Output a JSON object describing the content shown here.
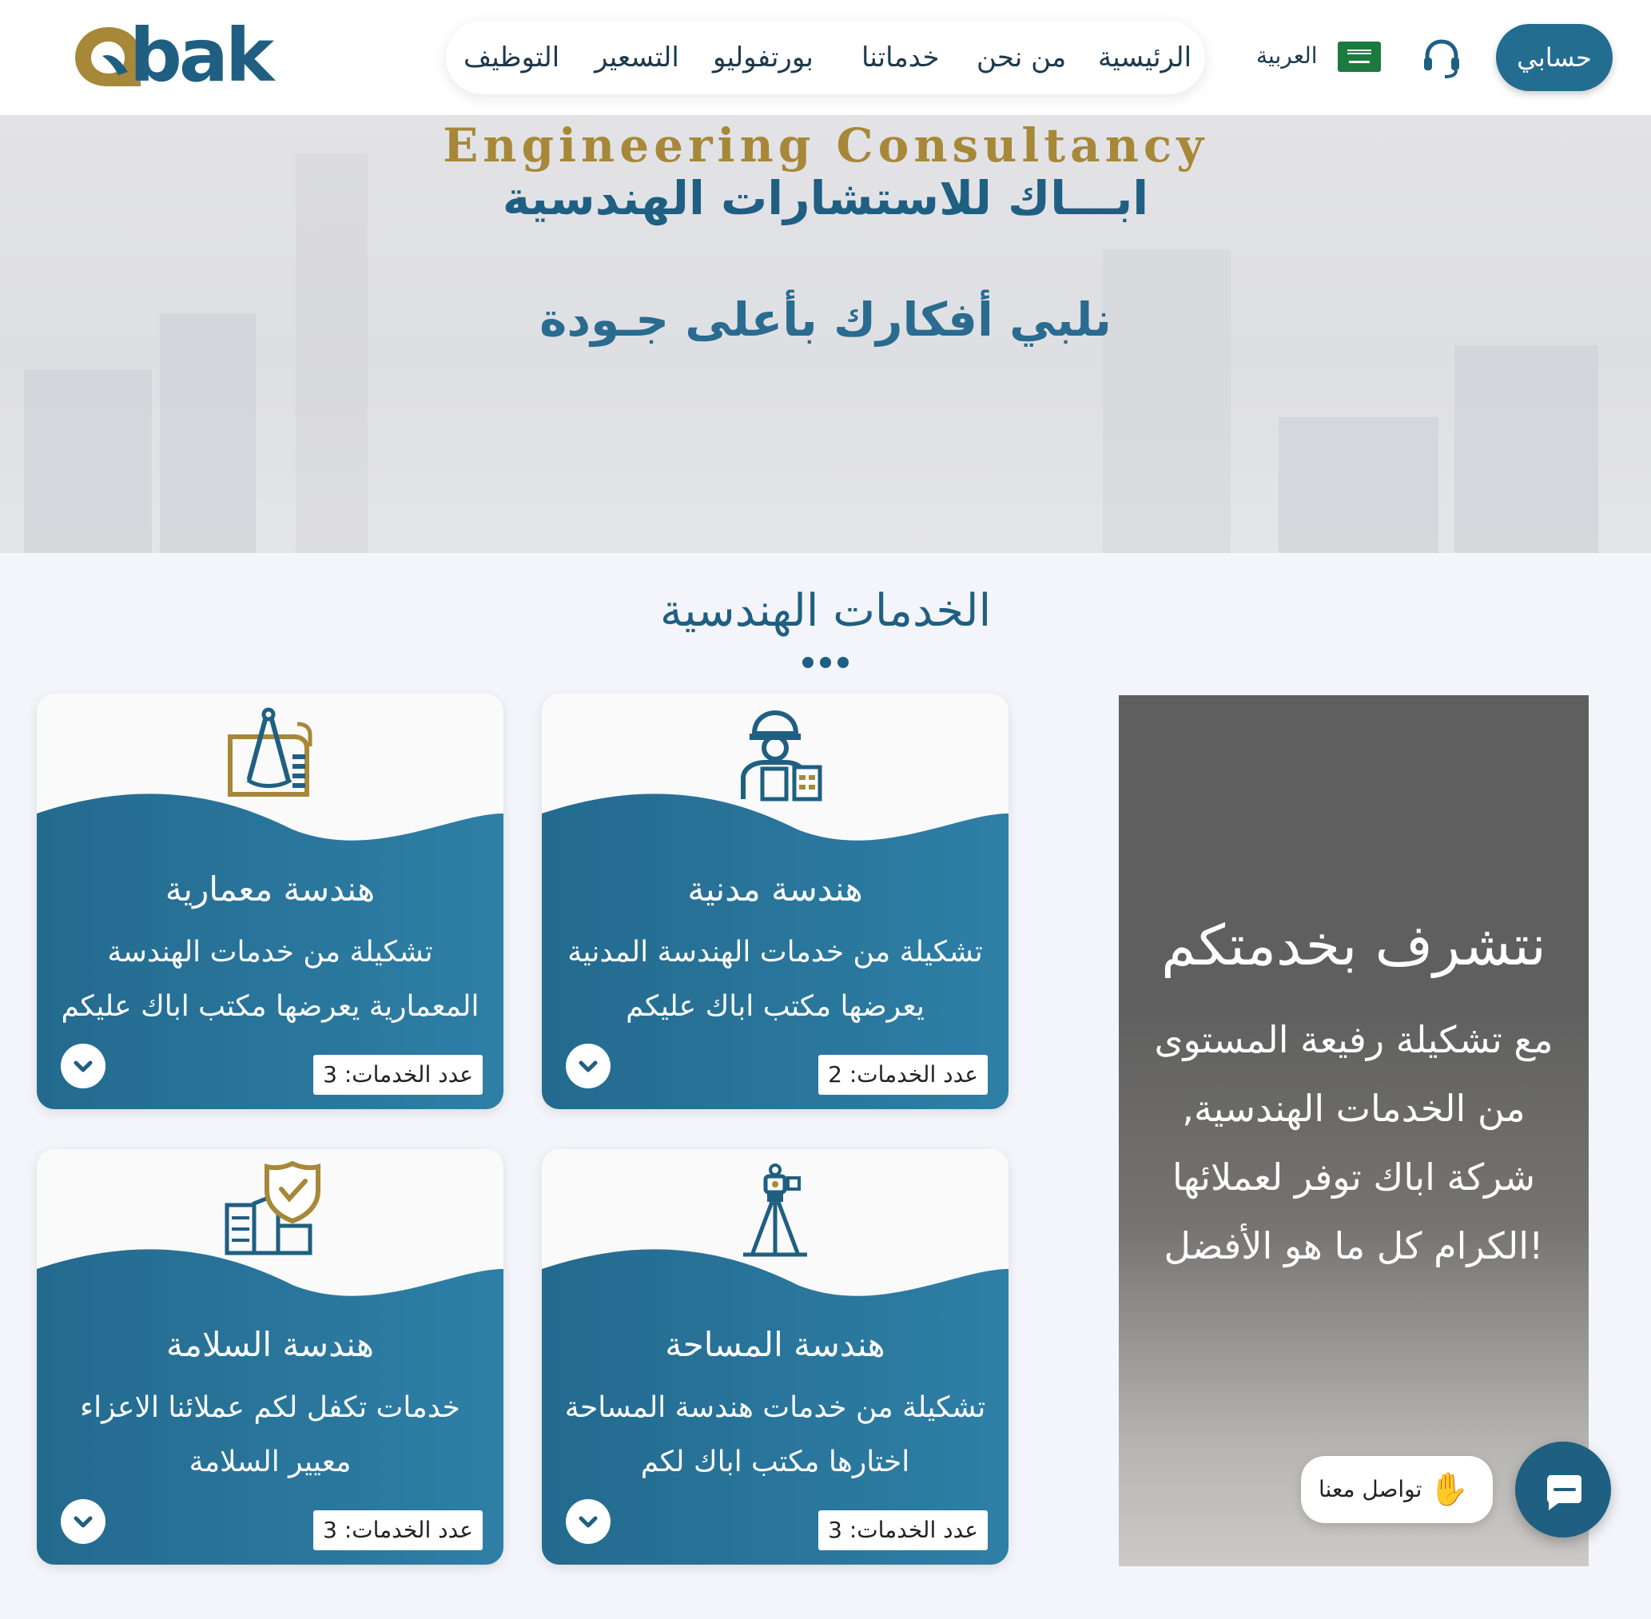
{
  "header": {
    "logo_text": "bak",
    "nav": [
      {
        "label": "الرئيسية"
      },
      {
        "label": "من نحن"
      },
      {
        "label": "خدماتنا"
      },
      {
        "label": "بورتفوليو"
      },
      {
        "label": "التسعير"
      },
      {
        "label": "التوظيف"
      }
    ],
    "language": "العربية",
    "language_flag": "saudi-flag-icon",
    "support_icon": "headset-icon",
    "account_label": "حسابي"
  },
  "hero": {
    "title_en": "Engineering Consultancy",
    "title_ar": "ابـــاك للاستشارات الهندسية",
    "tagline": "نلبي أفكارك بأعلى جـودة"
  },
  "services": {
    "title": "الخدمات الهندسية",
    "cards": [
      {
        "icon": "engineer-icon",
        "title": "هندسة مدنية",
        "description": "تشكيلة من خدمات الهندسة المدنية يعرضها مكتب اباك عليكم",
        "count": "عدد الخدمات: 2"
      },
      {
        "icon": "compass-blueprint-icon",
        "title": "هندسة معمارية",
        "description": "تشكيلة من خدمات الهندسة المعمارية يعرضها مكتب اباك عليكم",
        "count": "عدد الخدمات: 3"
      },
      {
        "icon": "surveying-tripod-icon",
        "title": "هندسة المساحة",
        "description": "تشكيلة من خدمات هندسة المساحة اختارها مكتب اباك لكم",
        "count": "عدد الخدمات: 3"
      },
      {
        "icon": "safety-shield-icon",
        "title": "هندسة السلامة",
        "description": "خدمات تكفل لكم عملائنا الاعزاء معيير السلامة",
        "count": "عدد الخدمات: 3"
      }
    ]
  },
  "side_panel": {
    "title": "نتشرف بخدمتكم",
    "text": "مع تشكيلة رفيعة المستوى من الخدمات الهندسية, شركة اباك توفر لعملائها الكرام كل ما هو الأفضل!"
  },
  "chat": {
    "label": "تواصل معنا",
    "emoji_icon": "waving-hand-icon",
    "button_icon": "chat-bubble-icon"
  },
  "colors": {
    "primary": "#1f5f82",
    "gold": "#a78838",
    "card_blue": "#2a7aa0"
  }
}
